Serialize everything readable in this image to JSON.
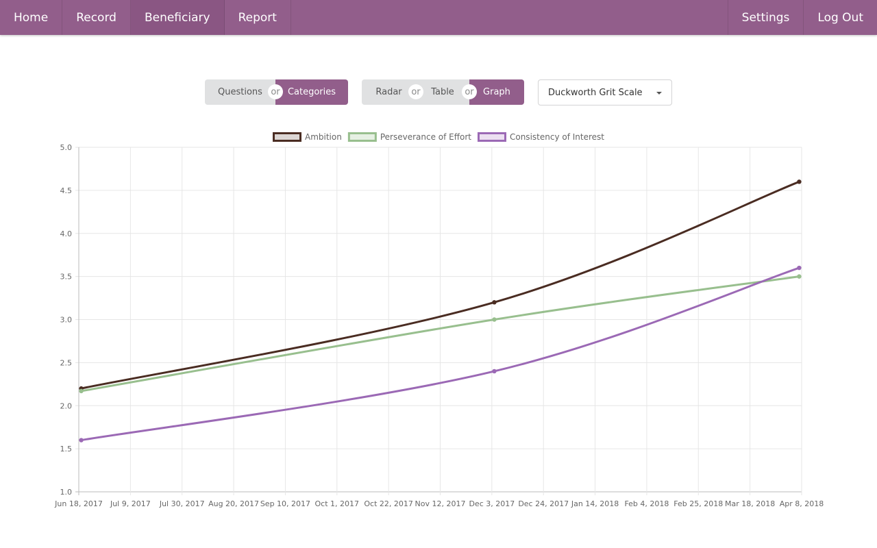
{
  "nav": {
    "left": [
      {
        "label": "Home"
      },
      {
        "label": "Record"
      },
      {
        "label": "Beneficiary"
      },
      {
        "label": "Report"
      }
    ],
    "right": [
      {
        "label": "Settings"
      },
      {
        "label": "Log Out"
      }
    ]
  },
  "controls": {
    "view_toggle": {
      "questions": "Questions",
      "categories": "Categories",
      "selected": "Categories"
    },
    "display_toggle": {
      "radar": "Radar",
      "table": "Table",
      "graph": "Graph",
      "selected": "Graph"
    },
    "or_label": "or",
    "scale_dropdown": {
      "value": "Duckworth Grit Scale"
    }
  },
  "colors": {
    "brand": "#925e8b",
    "ambition": "#4a2c22",
    "perseverance": "#98bf8e",
    "consistency": "#9b69b5"
  },
  "chart_data": {
    "type": "line",
    "title": "",
    "xlabel": "",
    "ylabel": "",
    "ylim": [
      1.0,
      5.0
    ],
    "y_ticks": [
      "1.0",
      "1.5",
      "2.0",
      "2.5",
      "3.0",
      "3.5",
      "4.0",
      "4.5",
      "5.0"
    ],
    "x_range": [
      "2017-06-18",
      "2018-04-08"
    ],
    "x_ticks": [
      "Jun 18, 2017",
      "Jul 9, 2017",
      "Jul 30, 2017",
      "Aug 20, 2017",
      "Sep 10, 2017",
      "Oct 1, 2017",
      "Oct 22, 2017",
      "Nov 12, 2017",
      "Dec 3, 2017",
      "Dec 24, 2017",
      "Jan 14, 2018",
      "Feb 4, 2018",
      "Feb 25, 2018",
      "Mar 18, 2018",
      "Apr 8, 2018"
    ],
    "grid": true,
    "legend_position": "top",
    "x": [
      "2017-06-19",
      "2017-12-04",
      "2018-04-07"
    ],
    "series": [
      {
        "name": "Ambition",
        "values": [
          2.2,
          3.2,
          4.6
        ]
      },
      {
        "name": "Perseverance of Effort",
        "values": [
          2.17,
          3.0,
          3.5
        ]
      },
      {
        "name": "Consistency of Interest",
        "values": [
          1.6,
          2.4,
          3.6
        ]
      }
    ]
  }
}
